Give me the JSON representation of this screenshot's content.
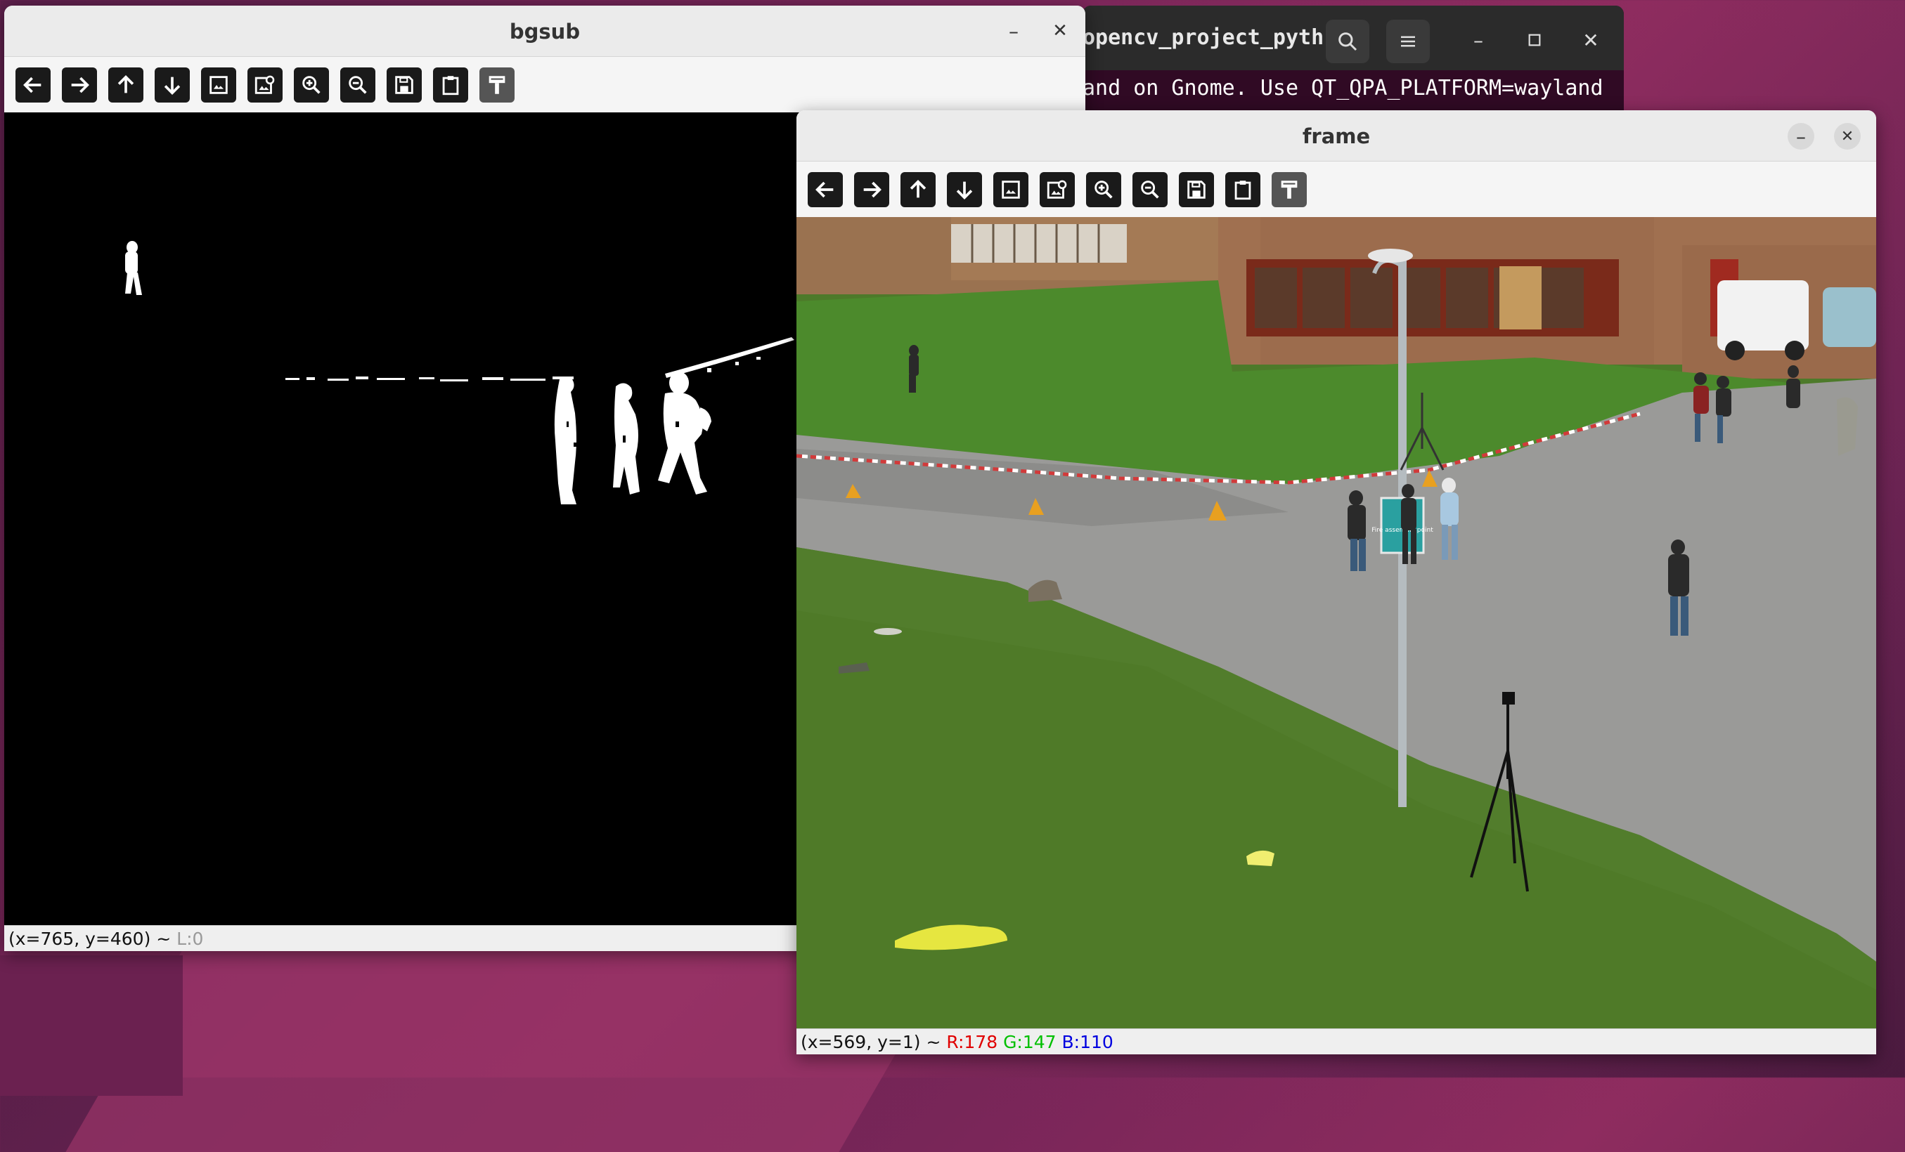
{
  "terminal": {
    "title": "opencv_project_pyth...",
    "output_line": "and on Gnome. Use QT_QPA_PLATFORM=wayland",
    "icons": [
      "search-icon",
      "hamburger-menu-icon",
      "minimize-icon",
      "maximize-icon",
      "close-icon"
    ]
  },
  "bgsub": {
    "title": "bgsub",
    "status_coords": "(x=765, y=460) ~",
    "status_layer": "L:0",
    "toolbar": [
      "pan-left-icon",
      "pan-right-icon",
      "pan-up-icon",
      "pan-down-icon",
      "zoom-fit-icon",
      "zoom-original-icon",
      "zoom-in-icon",
      "zoom-out-icon",
      "save-icon",
      "copy-clipboard-icon",
      "properties-icon"
    ]
  },
  "frame": {
    "title": "frame",
    "status_coords": "(x=569, y=1) ~",
    "status_r": "R:178",
    "status_g": "G:147",
    "status_b": "B:110",
    "sign_text": "Fire assembly point",
    "colors": {
      "r": "#e00000",
      "g": "#00c000",
      "b": "#0000e0"
    }
  }
}
